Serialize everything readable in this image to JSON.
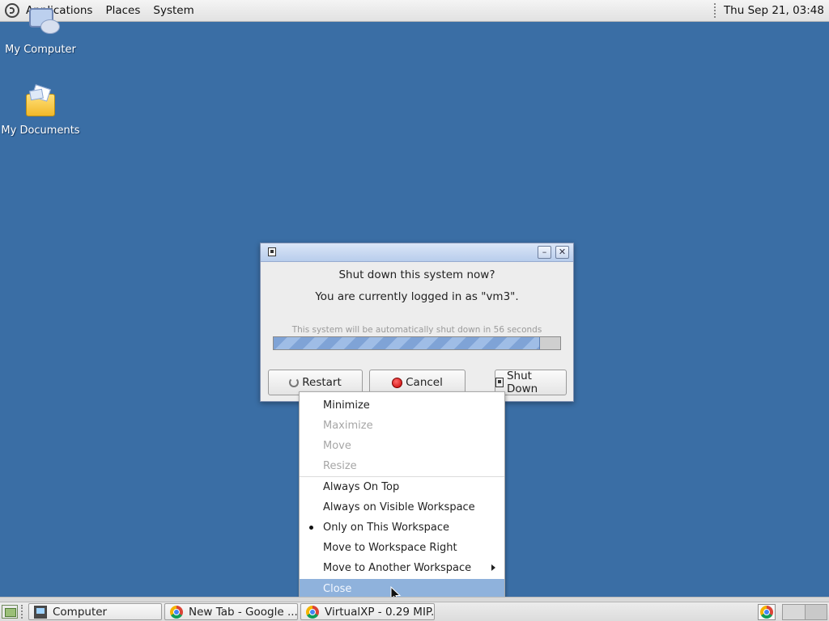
{
  "top_panel": {
    "applications": "Applications",
    "places": "Places",
    "system": "System",
    "clock": "Thu Sep 21, 03:48",
    "icon": "distro-logo-icon"
  },
  "desktop": {
    "icons": [
      {
        "label": "My Computer",
        "icon": "computer-icon"
      },
      {
        "label": "My Documents",
        "icon": "folder-icon"
      }
    ],
    "background_color": "#3a6ea5"
  },
  "dialog": {
    "heading": "Shut down this system now?",
    "user_message": "You are currently logged in as \"vm3\".",
    "countdown": "This system will be automatically shut down in 56 seconds",
    "progress_percent": 93,
    "buttons": {
      "restart": "Restart",
      "cancel": "Cancel",
      "shutdown": "Shut Down"
    }
  },
  "context_menu": {
    "items": [
      {
        "label": "Minimize",
        "enabled": true
      },
      {
        "label": "Maximize",
        "enabled": false
      },
      {
        "label": "Move",
        "enabled": false
      },
      {
        "label": "Resize",
        "enabled": false
      },
      {
        "label": "Always On Top",
        "enabled": true
      },
      {
        "label": "Always on Visible Workspace",
        "enabled": true
      },
      {
        "label": "Only on This Workspace",
        "enabled": true,
        "selected": true
      },
      {
        "label": "Move to Workspace Right",
        "enabled": true
      },
      {
        "label": "Move to Another Workspace",
        "enabled": true,
        "submenu": true
      },
      {
        "label": "Close",
        "enabled": true,
        "highlighted": true
      }
    ]
  },
  "taskbar": {
    "tasks": [
      {
        "label": "Computer",
        "icon": "terminal-icon"
      },
      {
        "label": "New Tab - Google ...",
        "icon": "chrome-icon"
      },
      {
        "label": "VirtualXP - 0.29 MIP...",
        "icon": "chrome-icon"
      }
    ]
  }
}
